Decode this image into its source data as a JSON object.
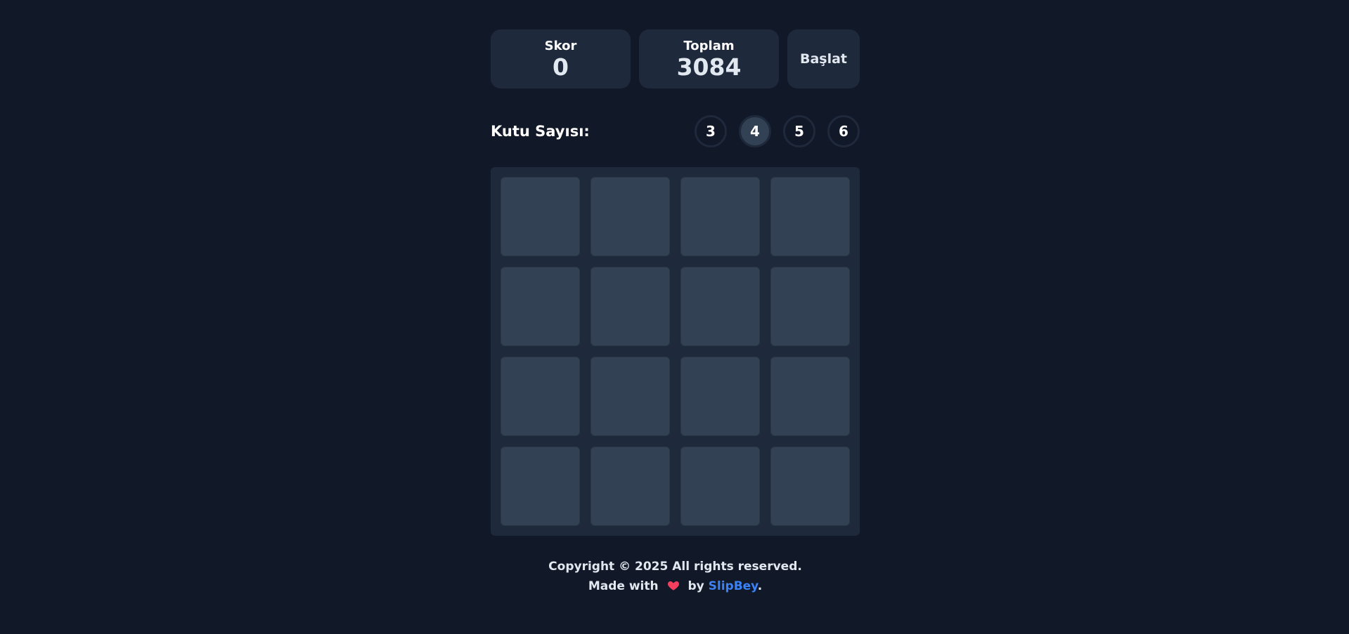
{
  "scoreboard": {
    "score_label": "Skor",
    "score_value": "0",
    "total_label": "Toplam",
    "total_value": "3084",
    "start_label": "Başlat"
  },
  "size_selector": {
    "label": "Kutu Sayısı:",
    "options": [
      "3",
      "4",
      "5",
      "6"
    ],
    "selected": "4"
  },
  "board": {
    "size": 4,
    "cells": [
      "",
      "",
      "",
      "",
      "",
      "",
      "",
      "",
      "",
      "",
      "",
      "",
      "",
      "",
      "",
      ""
    ]
  },
  "footer": {
    "copyright": "Copyright © 2025 All rights reserved.",
    "made_with_prefix": "Made with",
    "heart_icon": "heart-icon",
    "made_with_by": "by",
    "author": "SlipBey",
    "suffix": "."
  },
  "colors": {
    "background": "#111827",
    "panel": "#1e293b",
    "cell": "#334155",
    "link": "#3b82f6",
    "heart": "#f43f5e"
  }
}
